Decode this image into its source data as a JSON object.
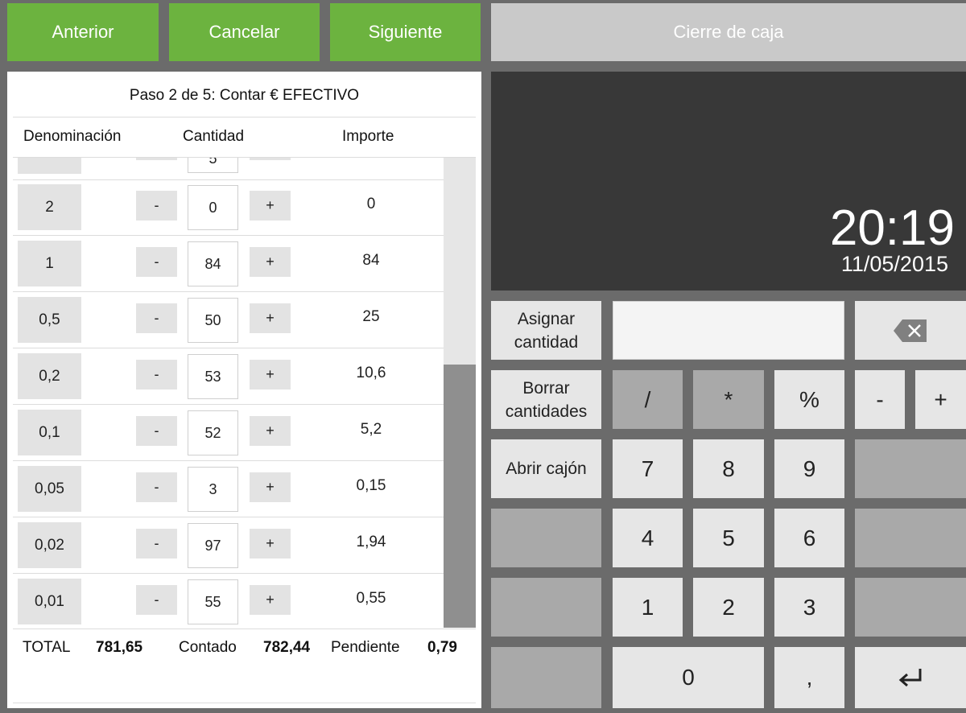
{
  "toolbar": {
    "prev_label": "Anterior",
    "cancel_label": "Cancelar",
    "next_label": "Siguiente",
    "title": "Cierre de caja"
  },
  "count": {
    "step_label": "Paso 2 de 5: Contar € EFECTIVO",
    "headers": {
      "denomination": "Denominación",
      "quantity": "Cantidad",
      "amount": "Importe"
    },
    "partial_row": {
      "quantity": "5"
    },
    "rows": [
      {
        "denomination": "2",
        "quantity": "0",
        "amount": "0"
      },
      {
        "denomination": "1",
        "quantity": "84",
        "amount": "84"
      },
      {
        "denomination": "0,5",
        "quantity": "50",
        "amount": "25"
      },
      {
        "denomination": "0,2",
        "quantity": "53",
        "amount": "10,6"
      },
      {
        "denomination": "0,1",
        "quantity": "52",
        "amount": "5,2"
      },
      {
        "denomination": "0,05",
        "quantity": "3",
        "amount": "0,15"
      },
      {
        "denomination": "0,02",
        "quantity": "97",
        "amount": "1,94"
      },
      {
        "denomination": "0,01",
        "quantity": "55",
        "amount": "0,55"
      }
    ],
    "minus_label": "-",
    "plus_label": "+",
    "totals": {
      "total_label": "TOTAL",
      "total_value": "781,65",
      "counted_label": "Contado",
      "counted_value": "782,44",
      "pending_label": "Pendiente",
      "pending_value": "0,79"
    }
  },
  "display": {
    "time": "20:19",
    "date": "11/05/2015"
  },
  "keypad": {
    "assign_label": "Asignar cantidad",
    "clear_label": "Borrar cantidades",
    "open_drawer_label": "Abrir cajón",
    "input_value": "",
    "backspace_icon": "backspace-icon",
    "enter_icon": "enter-icon",
    "ops": {
      "divide": "/",
      "multiply": "*",
      "percent": "%",
      "minus": "-",
      "plus": "+"
    },
    "digits": {
      "d7": "7",
      "d8": "8",
      "d9": "9",
      "d4": "4",
      "d5": "5",
      "d6": "6",
      "d1": "1",
      "d2": "2",
      "d3": "3",
      "d0": "0"
    },
    "comma": ","
  },
  "colors": {
    "accent": "#6cb33f",
    "display_bg": "#383838",
    "background": "#6b6b6b"
  }
}
